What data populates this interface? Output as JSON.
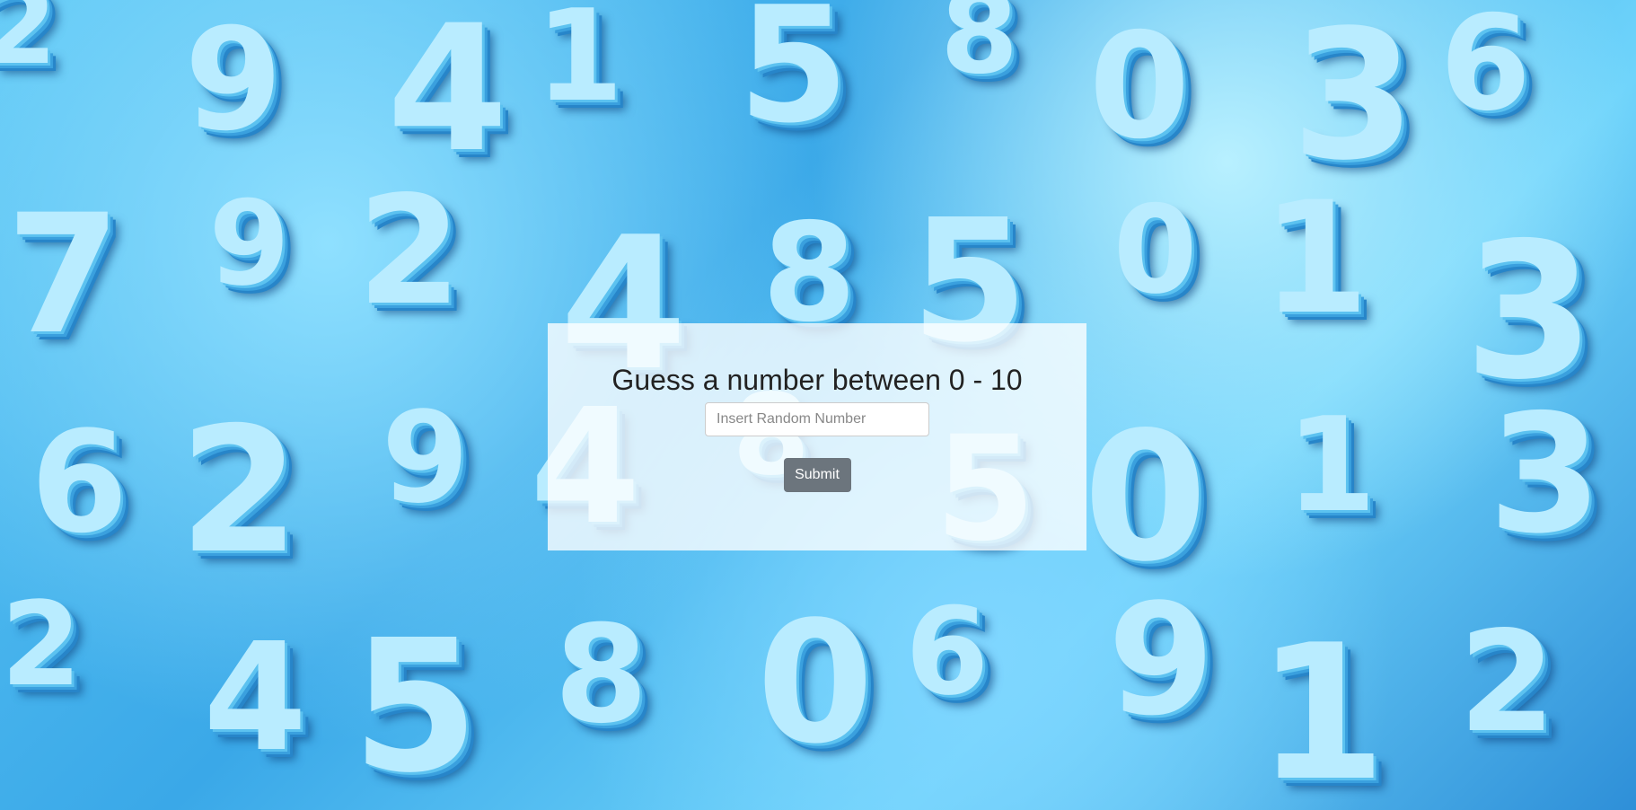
{
  "background": {
    "description_icon": "3d-numbers-background",
    "digits": [
      "2",
      "9",
      "4",
      "1",
      "5",
      "8",
      "0",
      "3",
      "6",
      "7",
      "9",
      "2",
      "4",
      "8",
      "5",
      "0",
      "1",
      "3",
      "6",
      "2",
      "9",
      "4",
      "8",
      "5",
      "0",
      "1",
      "3",
      "2",
      "4",
      "5",
      "8",
      "0",
      "6",
      "9",
      "1",
      "2"
    ]
  },
  "game": {
    "title": "Guess a number between 0 - 10",
    "input_placeholder": "Insert Random Number",
    "input_value": "",
    "submit_label": "Submit"
  },
  "colors": {
    "panel_bg": "rgba(255,255,255,0.78)",
    "button_bg": "#6c757d",
    "button_text": "#ffffff",
    "title_text": "#222222"
  }
}
